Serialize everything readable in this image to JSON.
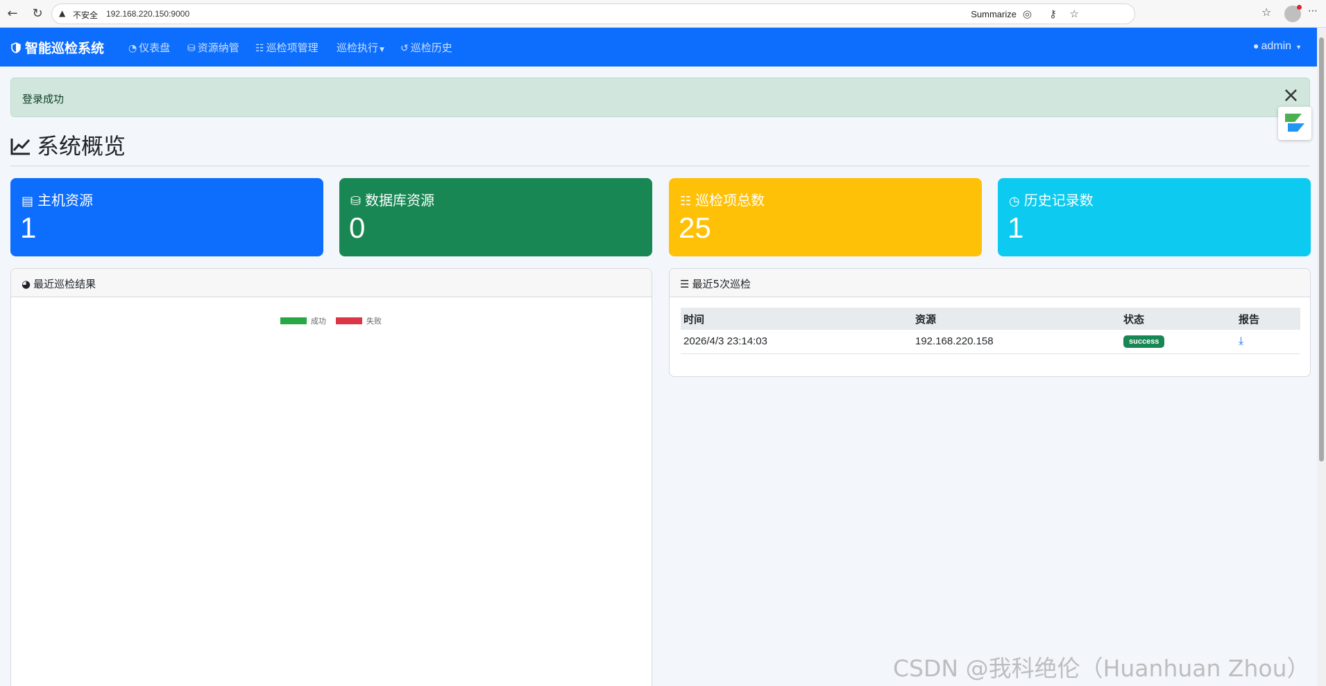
{
  "browser": {
    "insecure_label": "不安全",
    "url": "192.168.220.150:9000",
    "summarize_label": "Summarize"
  },
  "navbar": {
    "brand": "智能巡检系统",
    "items": [
      {
        "label": "仪表盘",
        "icon": "speedometer-icon"
      },
      {
        "label": "资源纳管",
        "icon": "database-icon"
      },
      {
        "label": "巡检项管理",
        "icon": "checklist-icon"
      },
      {
        "label": "巡检执行",
        "icon": "dropdown-caret-icon"
      },
      {
        "label": "巡检历史",
        "icon": "history-icon"
      }
    ],
    "user": "admin"
  },
  "alert": {
    "message": "登录成功"
  },
  "page": {
    "title": "系统概览"
  },
  "stats": [
    {
      "label": "主机资源",
      "value": "1",
      "color": "#0d6efd",
      "icon": "server-icon"
    },
    {
      "label": "数据库资源",
      "value": "0",
      "color": "#198754",
      "icon": "database-icon"
    },
    {
      "label": "巡检项总数",
      "value": "25",
      "color": "#ffc107",
      "icon": "checklist-icon"
    },
    {
      "label": "历史记录数",
      "value": "1",
      "color": "#0dcaf0",
      "icon": "clock-icon"
    }
  ],
  "recent_results": {
    "title": "最近巡检结果",
    "legend": [
      {
        "label": "成功",
        "color": "#28a745"
      },
      {
        "label": "失败",
        "color": "#dc3545"
      }
    ]
  },
  "recent_inspections": {
    "title": "最近5次巡检",
    "columns": [
      "时间",
      "资源",
      "状态",
      "报告"
    ],
    "rows": [
      {
        "time": "2026/4/3 23:14:03",
        "resource": "192.168.220.158",
        "status": "success"
      }
    ]
  },
  "watermark": "CSDN @我科绝伦（Huanhuan Zhou）"
}
